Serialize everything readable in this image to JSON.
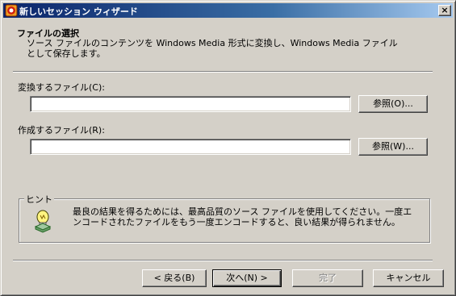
{
  "window": {
    "title": "新しいセッション ウィザード",
    "close_glyph": "×"
  },
  "header": {
    "title": "ファイルの選択",
    "description": "ソース ファイルのコンテンツを Windows Media 形式に変換し、Windows Media ファイルとして保存します。"
  },
  "source": {
    "label": "変換するファイル(C):",
    "value": "",
    "browse_label": "参照(O)..."
  },
  "output": {
    "label": "作成するファイル(R):",
    "value": "",
    "browse_label": "参照(W)..."
  },
  "hint": {
    "legend": "ヒント",
    "text": "最良の結果を得るためには、最高品質のソース ファイルを使用してください。一度エンコードされたファイルをもう一度エンコードすると、良い結果が得られません。",
    "icon": "lightbulb-icon"
  },
  "buttons": {
    "back": "< 戻る(B)",
    "next": "次へ(N) >",
    "finish": "完了",
    "cancel": "キャンセル"
  },
  "colors": {
    "face": "#d4d0c8",
    "title_active": "#0a246a",
    "title_gradient_end": "#a6caf0"
  }
}
